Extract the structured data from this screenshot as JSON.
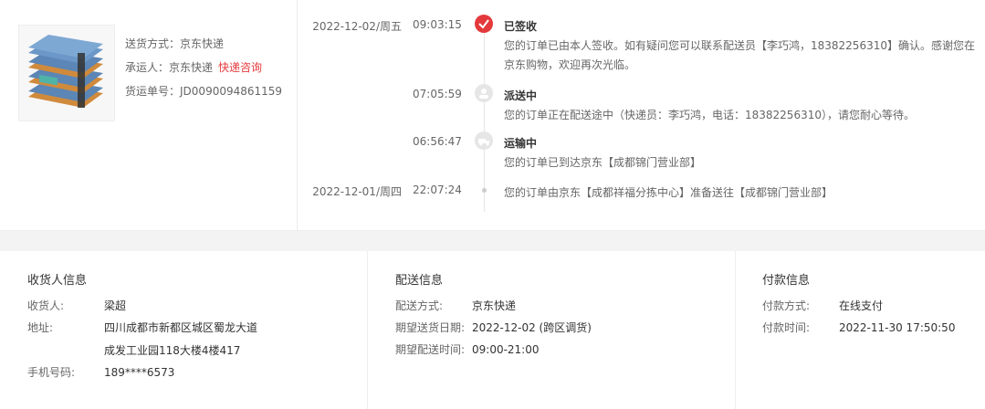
{
  "shipping": {
    "method_label": "送货方式：",
    "method_value": "京东快递",
    "carrier_label": "承运人：",
    "carrier_value": "京东快递",
    "carrier_link": "快递咨询",
    "tracking_label": "货运单号：",
    "tracking_value": "JD0090094861159"
  },
  "timeline": [
    {
      "date": "2022-12-02/周五",
      "time": "09:03:15",
      "status": "已签收",
      "text": "您的订单已由本人签收。如有疑问您可以联系配送员【李巧鸿，18382256310】确认。感谢您在京东购物，欢迎再次光临。",
      "icon": "check-icon"
    },
    {
      "date": "",
      "time": "07:05:59",
      "status": "派送中",
      "text": "您的订单正在配送途中（快递员：李巧鸿，电话：18382256310），请您耐心等待。",
      "icon": "courier-icon"
    },
    {
      "date": "",
      "time": "06:56:47",
      "status": "运输中",
      "text": "您的订单已到达京东【成都锦门营业部】",
      "icon": "truck-icon"
    },
    {
      "date": "2022-12-01/周四",
      "time": "22:07:24",
      "status": "",
      "text": "您的订单由京东【成都祥福分拣中心】准备送往【成都锦门营业部】",
      "icon": "dot-icon"
    }
  ],
  "receiver": {
    "title": "收货人信息",
    "name_label": "收货人:",
    "name_value": "梁超",
    "addr_label": "地址:",
    "addr_line1": "四川成都市新都区城区蜀龙大道",
    "addr_line2": "成发工业园118大楼4楼417",
    "phone_label": "手机号码:",
    "phone_value": "189****6573"
  },
  "delivery": {
    "title": "配送信息",
    "method_label": "配送方式:",
    "method_value": "京东快递",
    "date_label": "期望送货日期:",
    "date_value": "2022-12-02 (跨区调货)",
    "time_label": "期望配送时间:",
    "time_value": "09:00-21:00"
  },
  "payment": {
    "title": "付款信息",
    "method_label": "付款方式:",
    "method_value": "在线支付",
    "time_label": "付款时间:",
    "time_value": "2022-11-30 17:50:50"
  },
  "colors": {
    "accent": "#e4393c",
    "text": "#333333",
    "muted": "#666666"
  }
}
